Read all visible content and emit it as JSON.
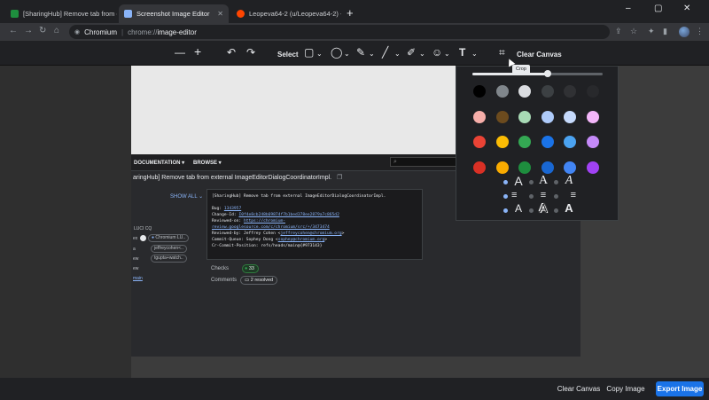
{
  "browser": {
    "tabs": [
      {
        "title": "[SharingHub] Remove tab from e",
        "favicon_color": "#1e8e3e",
        "active": false
      },
      {
        "title": "Screenshot Image Editor",
        "favicon_color": "#8ab4f8",
        "active": true
      },
      {
        "title": "Leopeva64-2 (u/Leopeva64-2) - R",
        "favicon_color": "#ff4500",
        "active": false
      }
    ],
    "new_tab": "+",
    "window_controls": {
      "minimize": "–",
      "maximize": "▢",
      "close": "✕"
    },
    "omnibox": {
      "site": "Chromium",
      "scheme": "chrome://",
      "path": "image-editor"
    }
  },
  "editor_toolbar": {
    "zoom_out": "—",
    "zoom_in": "+",
    "undo": "↶",
    "redo": "↷",
    "select_label": "Select",
    "shape_rect": "▢",
    "shape_circle": "◯",
    "chevron": "⌄",
    "pen": "✎",
    "line": "╱",
    "highlighter": "✐",
    "emoji": "☺",
    "text": "T",
    "crop": "⌗",
    "clear_canvas_label": "Clear Canvas",
    "crop_tooltip": "Crop"
  },
  "text_popup": {
    "size_fraction": 0.58,
    "colors": [
      "#000000",
      "#80868b",
      "#dadce0",
      "#3c4043",
      "#303134",
      "#28292c",
      "#f6aea9",
      "#6c4b1e",
      "#a8dab5",
      "#aecbfa",
      "#c6dafc",
      "#f3b6f9",
      "#ea4335",
      "#fbbc04",
      "#34a853",
      "#1a73e8",
      "#4ba3f1",
      "#c58af9",
      "#d93025",
      "#f9ab00",
      "#1e8e3e",
      "#1967d2",
      "#4285f4",
      "#a142f4"
    ],
    "font_sample": "A",
    "align_icons": [
      "≡",
      "≡",
      "≡",
      "≡"
    ]
  },
  "screenshot": {
    "nav_documentation": "DOCUMENTATION ▾",
    "nav_browse": "BROWSE ▾",
    "search_icon": "⌕",
    "header": "aringHub] Remove tab from external ImageEditorDialogCoordinatorImpl.",
    "show_all": "SHOW ALL ⌄",
    "luci": "LUCI CQ",
    "chip_chromium": "Chromium LU..",
    "chip_jeffrey": "jeffreycohen<..",
    "chip_tgupta": "tgupta+watch..",
    "side_ex": "ex",
    "side_a": "a",
    "side_ew": "ew",
    "side_main": "main",
    "commit_lines": {
      "title": "[SharingHub] Remove tab from external ImageEditorDialogCoordinatorImpl.",
      "bug_label": "Bug: ",
      "bug_value": "1343957",
      "change_label": "Change-Id: ",
      "change_value": "I0f4e8cb248b69874f7b1bed378ee2879a7c865d2",
      "reviewed_label": "Reviewed-on: ",
      "reviewed_value": "https://chromium-",
      "reviewed_value2": "review.googlesource.com/c/chromium/src/+/3473474",
      "reviewed_by_label": "Reviewed-by: Jeffrey Cohen <",
      "reviewed_by_value": "jeffreycohen@chromium.org",
      "commit_queue_label": "Commit-Queue: Sophey Dong <",
      "commit_queue_value": "sophey@chromium.org",
      "cr_commit": "Cr-Commit-Position: refs/heads/main@{#973143}"
    },
    "checks_label": "Checks",
    "checks_count": "33",
    "comments_label": "Comments",
    "comments_value": "2 resolved"
  },
  "bottom_bar": {
    "clear_canvas": "Clear Canvas",
    "copy_image": "Copy Image",
    "export_image": "Export Image"
  }
}
